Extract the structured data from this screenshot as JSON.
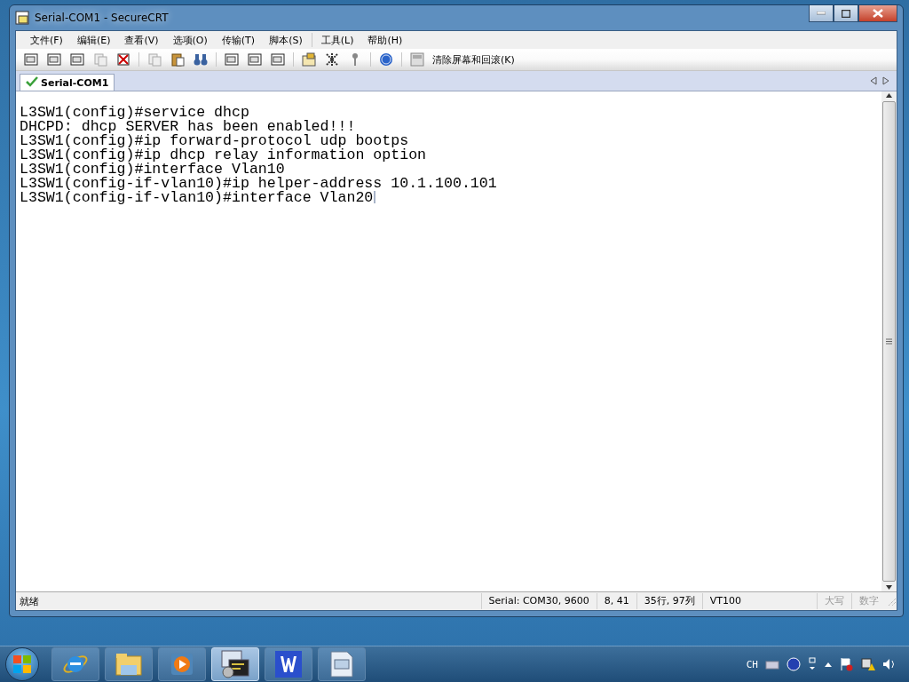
{
  "window": {
    "title": "Serial-COM1 - SecureCRT"
  },
  "menu": [
    "文件(F)",
    "编辑(E)",
    "查看(V)",
    "选项(O)",
    "传输(T)",
    "脚本(S)",
    "工具(L)",
    "帮助(H)"
  ],
  "toolbar": {
    "clear_label": "清除屏幕和回滚(K)"
  },
  "tabs": [
    {
      "label": "Serial-COM1",
      "selected": true,
      "connected": true
    }
  ],
  "terminal": {
    "lines": [
      "L3SW1(config)#service dhcp",
      "DHCPD: dhcp SERVER has been enabled!!!",
      "L3SW1(config)#ip forward-protocol udp bootps",
      "L3SW1(config)#ip dhcp relay information option",
      "L3SW1(config)#interface Vlan10",
      "L3SW1(config-if-vlan10)#ip helper-address 10.1.100.101",
      "L3SW1(config-if-vlan10)#interface Vlan20"
    ],
    "cursor": true
  },
  "status_bar": {
    "message": "就绪",
    "fields": [
      {
        "text": "Serial: COM30, 9600",
        "disabled": false
      },
      {
        "text": "8,  41",
        "disabled": false
      },
      {
        "text": "35行, 97列",
        "disabled": false
      },
      {
        "text": "VT100",
        "disabled": false
      },
      {
        "text": "大写",
        "disabled": true
      },
      {
        "text": "数字",
        "disabled": true
      }
    ]
  },
  "taskbar": {
    "buttons": [
      {
        "kind": "ie",
        "selected": false
      },
      {
        "kind": "explorer",
        "selected": false
      },
      {
        "kind": "media",
        "selected": false
      },
      {
        "kind": "securecrt",
        "selected": true
      },
      {
        "kind": "wps",
        "selected": false
      },
      {
        "kind": "document",
        "selected": false
      }
    ],
    "tray_language": "CH"
  }
}
